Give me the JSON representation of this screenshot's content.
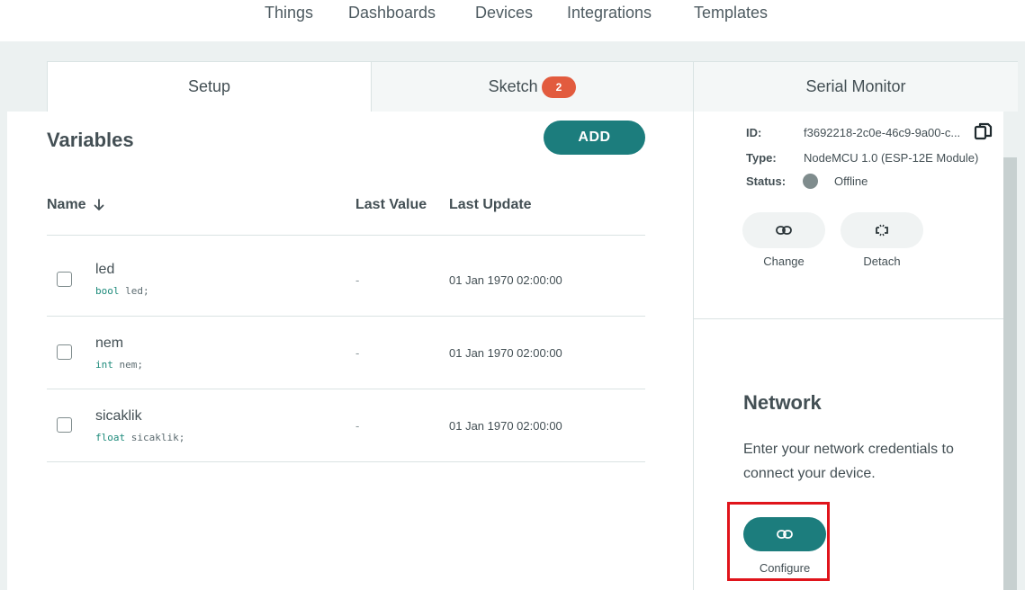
{
  "nav": {
    "items": [
      "Things",
      "Dashboards",
      "Devices",
      "Integrations",
      "Templates"
    ]
  },
  "tabs": {
    "setup": "Setup",
    "sketch": "Sketch",
    "sketch_badge": "2",
    "serial": "Serial Monitor"
  },
  "variables": {
    "title": "Variables",
    "add_label": "ADD",
    "columns": {
      "name": "Name",
      "sort_icon": "arrow-down-icon",
      "last_value": "Last Value",
      "last_update": "Last Update"
    },
    "rows": [
      {
        "name": "led",
        "type": "bool",
        "var": "led;",
        "last_value": "-",
        "last_update": "01 Jan 1970 02:00:00"
      },
      {
        "name": "nem",
        "type": "int",
        "var": "nem;",
        "last_value": "-",
        "last_update": "01 Jan 1970 02:00:00"
      },
      {
        "name": "sicaklik",
        "type": "float",
        "var": "sicaklik;",
        "last_value": "-",
        "last_update": "01 Jan 1970 02:00:00"
      }
    ]
  },
  "device": {
    "id_label": "ID:",
    "id_value": "f3692218-2c0e-46c9-9a00-c...",
    "type_label": "Type:",
    "type_value": "NodeMCU 1.0 (ESP-12E Module)",
    "status_label": "Status:",
    "status_value": "Offline",
    "status_color": "#7f8c8d",
    "change_label": "Change",
    "detach_label": "Detach"
  },
  "network": {
    "title": "Network",
    "description": "Enter your network credentials to connect your device.",
    "configure_label": "Configure"
  },
  "colors": {
    "accent": "#1c7d7d",
    "badge": "#e25b3e",
    "highlight_box": "#e0141b"
  }
}
